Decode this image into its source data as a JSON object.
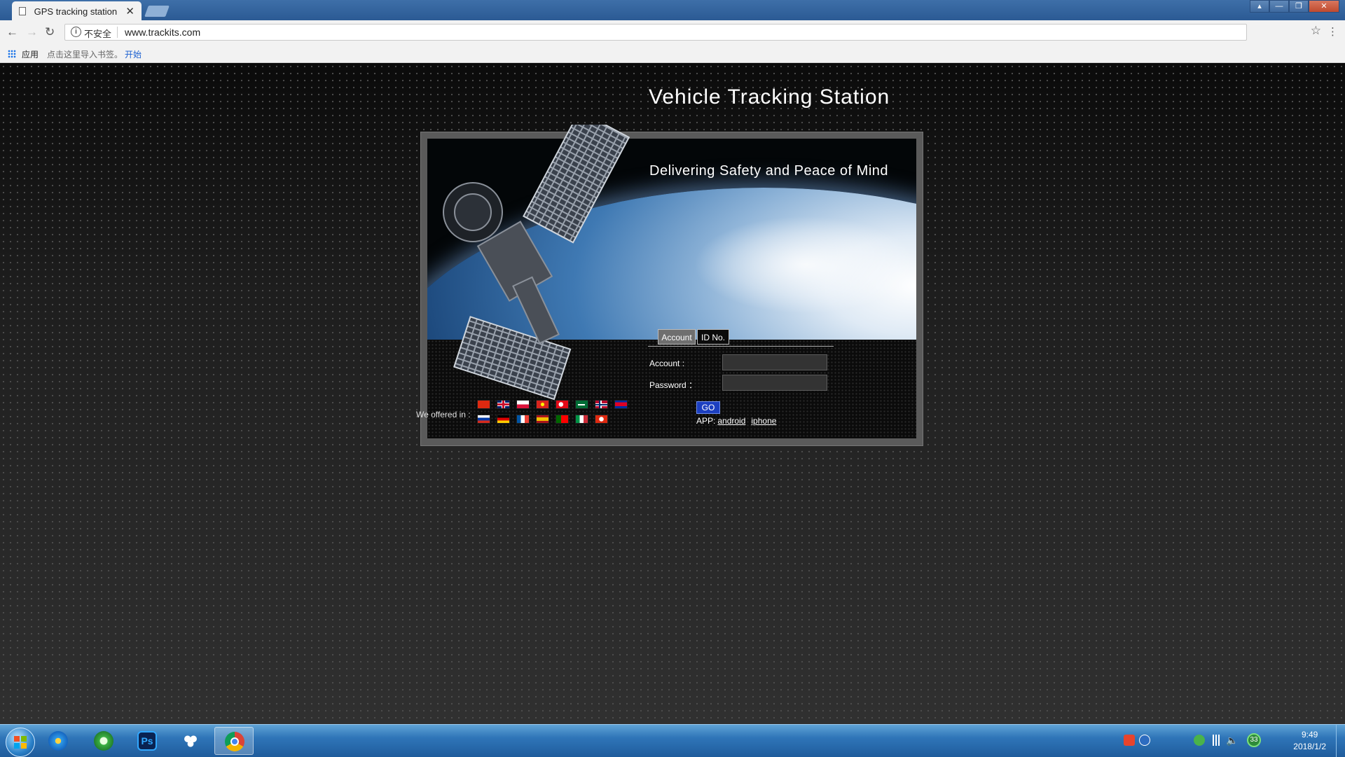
{
  "browser": {
    "tab_title": "GPS tracking station",
    "tab_close": "✕",
    "security_label": "不安全",
    "url": "www.trackits.com",
    "bookmarks": {
      "apps": "应用",
      "import_text": "点击这里导入书签。",
      "start_link": "开始"
    },
    "window_buttons": [
      "▴",
      "—",
      "❐",
      "✕"
    ]
  },
  "page": {
    "title": "Vehicle Tracking Station",
    "tagline": "Delivering Safety and Peace of Mind",
    "login": {
      "tabs": [
        "Account",
        "ID No."
      ],
      "active_tab": "Account",
      "account_label": "Account :",
      "password_label": "Password ：",
      "account_value": "",
      "password_value": "",
      "go_label": "GO",
      "app_label": "APP:",
      "android_link": "android",
      "iphone_link": "iphone"
    },
    "languages_label": "We offered in :",
    "flags_row1": [
      "china",
      "united-kingdom",
      "poland",
      "vietnam",
      "turkey",
      "saudi-arabia",
      "norway",
      "cambodia"
    ],
    "flags_row2": [
      "russia",
      "germany",
      "france",
      "spain",
      "portugal",
      "italy",
      "hong-kong"
    ]
  },
  "taskbar": {
    "time": "9:49",
    "date": "2018/1/2",
    "pinned": [
      "ie-icon",
      "360-browser-icon",
      "photoshop-icon",
      "baidu-cloud-icon",
      "chrome-icon"
    ],
    "ps_label": "Ps",
    "tray_badge": "33"
  }
}
